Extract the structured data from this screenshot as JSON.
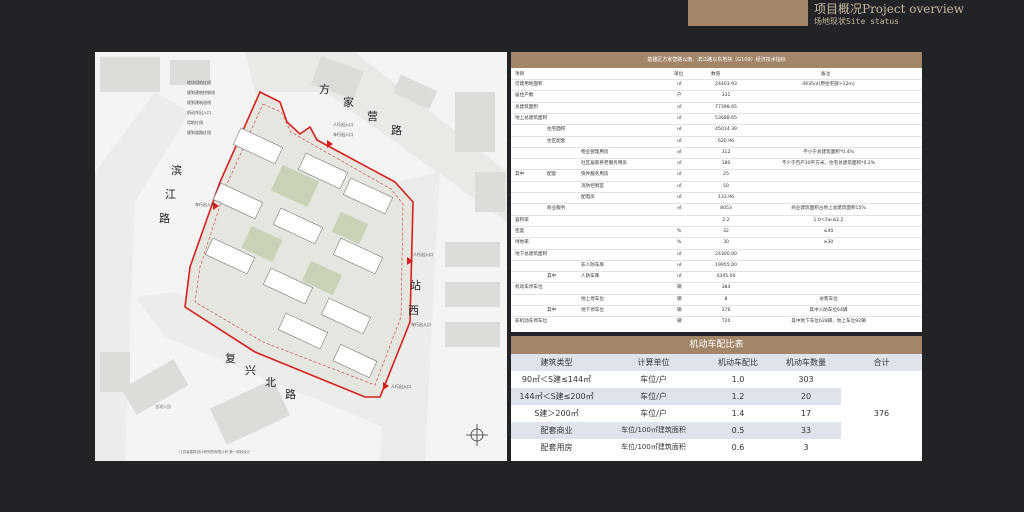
{
  "header": {
    "title": "项目概况Project overview",
    "subtitle": "场地现状Site status"
  },
  "site_plan": {
    "legend": [
      "地块用地红线",
      "规划建筑控制线",
      "规划建筑退线",
      "机动车出入口",
      "用地红线",
      "规划道路红线"
    ],
    "roads": {
      "north": [
        "方",
        "家",
        "营",
        "路"
      ],
      "west": [
        "滨",
        "江",
        "路"
      ],
      "east": [
        "站",
        "西",
        "路"
      ],
      "south": [
        "复",
        "兴",
        "北",
        "路"
      ]
    },
    "gates": [
      "人行出入口",
      "车行出入口",
      "车行出入口",
      "人行出入口",
      "车行出入口",
      "人行出入口"
    ],
    "caption": "江苏省建筑设计研究院有限公司 第一规划设计",
    "misc_labels": [
      "龙湖公园"
    ]
  },
  "tech_table": {
    "title": "楚雄区方家营路以南、滨江路以东地块（G109）经济技术指标",
    "headers": [
      "项目",
      "单位",
      "数值",
      "备注"
    ],
    "rows": [
      {
        "c1": "可建用地面积",
        "c2": "",
        "c3": "",
        "unit": "㎡",
        "value": "24403.93",
        "note": "4635㎡(原住宅部>12m)"
      },
      {
        "c1": "居住户数",
        "c2": "",
        "c3": "",
        "unit": "户",
        "value": "331",
        "note": ""
      },
      {
        "c1": "总建筑面积",
        "c2": "",
        "c3": "",
        "unit": "㎡",
        "value": "77398.65",
        "note": ""
      },
      {
        "c1": "地上总建筑面积",
        "c2": "",
        "c3": "",
        "unit": "㎡",
        "value": "53688.65",
        "note": ""
      },
      {
        "c1": "",
        "c2": "住宅面积",
        "c3": "",
        "unit": "㎡",
        "value": "45014.39",
        "note": ""
      },
      {
        "c1": "",
        "c2": "住区配套",
        "c3": "",
        "unit": "㎡",
        "value": "620.96",
        "note": ""
      },
      {
        "c1": "",
        "c2": "",
        "c3": "物业管理用房",
        "unit": "㎡",
        "value": "312",
        "note": "不小于总建筑面积*0.4%"
      },
      {
        "c1": "",
        "c2": "",
        "c3": "社区居家养老服务用房",
        "unit": "㎡",
        "value": "180",
        "note": "不少于百户30平方米，住宅总建筑面积*0.2%"
      },
      {
        "c1": "其中",
        "c2": "配套",
        "c3": "快件服务用房",
        "unit": "㎡",
        "value": "25",
        "note": ""
      },
      {
        "c1": "",
        "c2": "",
        "c3": "消防控制室",
        "unit": "㎡",
        "value": "50",
        "note": ""
      },
      {
        "c1": "",
        "c2": "",
        "c3": "配电房",
        "unit": "㎡",
        "value": "133.96",
        "note": ""
      },
      {
        "c1": "",
        "c2": "商业服务",
        "c3": "",
        "unit": "㎡",
        "value": "8053",
        "note": "商业建筑面积占地上总建筑面积15%"
      },
      {
        "c1": "容积率",
        "c2": "",
        "c3": "",
        "unit": "",
        "value": "2.2",
        "note": "1.0＜Far≤2.2"
      },
      {
        "c1": "密度",
        "c2": "",
        "c3": "",
        "unit": "%",
        "value": "32",
        "note": "≤40"
      },
      {
        "c1": "绿地率",
        "c2": "",
        "c3": "",
        "unit": "%",
        "value": "30",
        "note": "≥30"
      },
      {
        "c1": "地下总建筑面积",
        "c2": "",
        "c3": "",
        "unit": "㎡",
        "value": "24300.00",
        "note": ""
      },
      {
        "c1": "",
        "c2": "",
        "c3": "非人防车库",
        "unit": "㎡",
        "value": "19955.00",
        "note": ""
      },
      {
        "c1": "",
        "c2": "其中",
        "c3": "人防车库",
        "unit": "㎡",
        "value": "4345.00",
        "note": ""
      },
      {
        "c1": "机动车停车位",
        "c2": "",
        "c3": "",
        "unit": "辆",
        "value": "384",
        "note": ""
      },
      {
        "c1": "",
        "c2": "",
        "c3": "地上停车位",
        "unit": "辆",
        "value": "8",
        "note": "访客车位"
      },
      {
        "c1": "",
        "c2": "其中",
        "c3": "地下停车位",
        "unit": "辆",
        "value": "376",
        "note": "其中人防车位64辆"
      },
      {
        "c1": "非机动车停车位",
        "c2": "",
        "c3": "",
        "unit": "辆",
        "value": "720",
        "note": "其中地下车位628辆，地上车位92辆"
      }
    ]
  },
  "parking_table": {
    "title": "机动车配比表",
    "headers": [
      "建筑类型",
      "计算单位",
      "机动车配比",
      "机动车数量",
      "合计"
    ],
    "rows": [
      {
        "type": "90㎡＜S建≤144㎡",
        "unit": "车位/户",
        "ratio": "1.0",
        "count": "303"
      },
      {
        "type": "144㎡＜S建≤200㎡",
        "unit": "车位/户",
        "ratio": "1.2",
        "count": "20"
      },
      {
        "type": "S建＞200㎡",
        "unit": "车位/户",
        "ratio": "1.4",
        "count": "17"
      },
      {
        "type": "配套商业",
        "unit": "车位/100㎡建筑面积",
        "ratio": "0.5",
        "count": "33"
      },
      {
        "type": "配套用房",
        "unit": "车位/100㎡建筑面积",
        "ratio": "0.6",
        "count": "3"
      }
    ],
    "total": "376"
  }
}
